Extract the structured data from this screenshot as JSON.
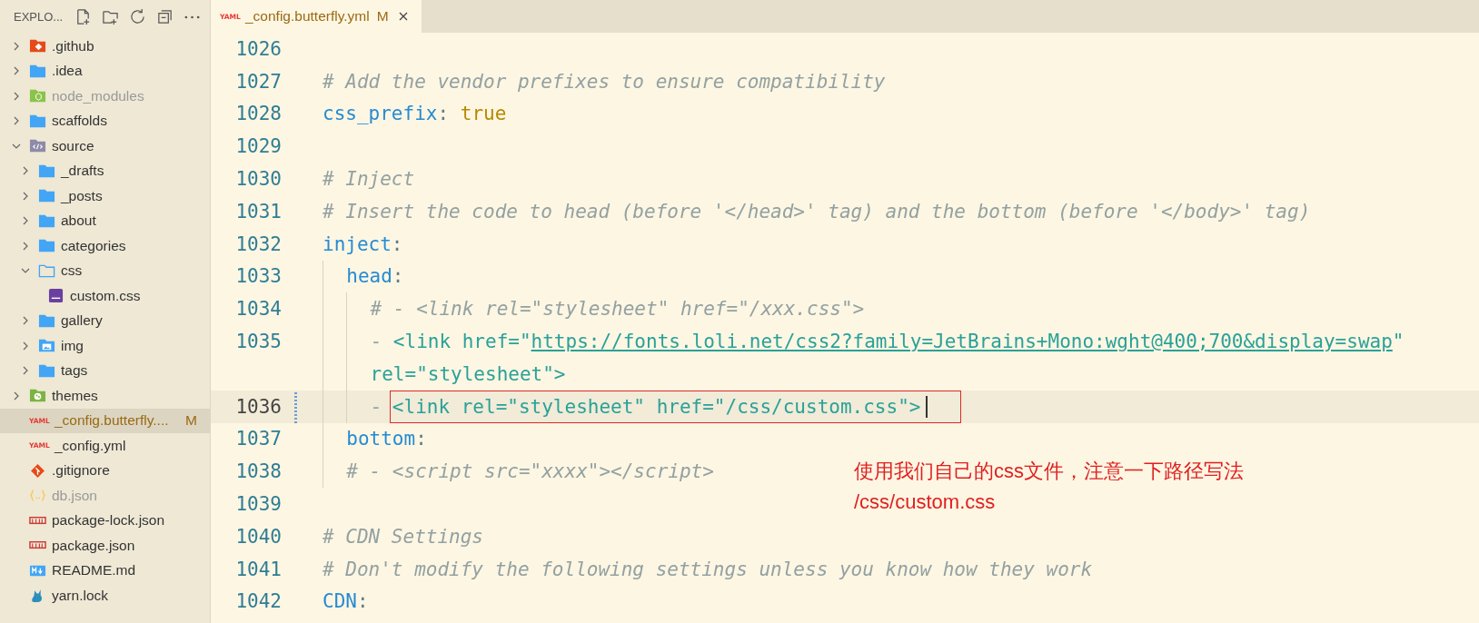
{
  "explorer": {
    "title": "EXPLO..."
  },
  "tree": [
    {
      "name": ".github",
      "kind": "git-folder",
      "expanded": false,
      "selected": false,
      "ignored": false
    },
    {
      "name": ".idea",
      "kind": "folder",
      "expanded": false,
      "selected": false,
      "ignored": false
    },
    {
      "name": "node_modules",
      "kind": "node-folder",
      "expanded": false,
      "selected": false,
      "ignored": true
    },
    {
      "name": "scaffolds",
      "kind": "folder",
      "expanded": false,
      "selected": false,
      "ignored": false
    },
    {
      "name": "source",
      "kind": "source-folder",
      "expanded": true,
      "selected": false,
      "ignored": false,
      "children": [
        {
          "name": "_drafts",
          "kind": "folder",
          "expanded": false,
          "selected": false,
          "ignored": false
        },
        {
          "name": "_posts",
          "kind": "folder",
          "expanded": false,
          "selected": false,
          "ignored": false
        },
        {
          "name": "about",
          "kind": "folder",
          "expanded": false,
          "selected": false,
          "ignored": false
        },
        {
          "name": "categories",
          "kind": "folder",
          "expanded": false,
          "selected": false,
          "ignored": false
        },
        {
          "name": "css",
          "kind": "folder",
          "expanded": true,
          "selected": false,
          "ignored": false,
          "children": [
            {
              "name": "custom.css",
              "kind": "css",
              "selected": false,
              "ignored": false
            }
          ]
        },
        {
          "name": "gallery",
          "kind": "folder",
          "expanded": false,
          "selected": false,
          "ignored": false
        },
        {
          "name": "img",
          "kind": "image-folder",
          "expanded": false,
          "selected": false,
          "ignored": false
        },
        {
          "name": "tags",
          "kind": "folder",
          "expanded": false,
          "selected": false,
          "ignored": false
        }
      ]
    },
    {
      "name": "themes",
      "kind": "theme-folder",
      "expanded": false,
      "selected": false,
      "ignored": false
    },
    {
      "name": "_config.butterfly....",
      "kind": "yaml",
      "icon_label": "YAML",
      "status": "M",
      "selected": true,
      "ignored": false
    },
    {
      "name": "_config.yml",
      "kind": "yaml",
      "icon_label": "YAML",
      "selected": false,
      "ignored": false
    },
    {
      "name": ".gitignore",
      "kind": "git",
      "selected": false,
      "ignored": false
    },
    {
      "name": "db.json",
      "kind": "json",
      "selected": false,
      "ignored": true
    },
    {
      "name": "package-lock.json",
      "kind": "npm",
      "selected": false,
      "ignored": false
    },
    {
      "name": "package.json",
      "kind": "npm",
      "selected": false,
      "ignored": false
    },
    {
      "name": "README.md",
      "kind": "markdown",
      "selected": false,
      "ignored": false
    },
    {
      "name": "yarn.lock",
      "kind": "yarn",
      "selected": false,
      "ignored": false
    }
  ],
  "tabs": [
    {
      "label": "_config.butterfly.yml",
      "icon_label": "YAML",
      "status": "M",
      "selected": true
    }
  ],
  "lines": [
    {
      "number": "1026",
      "current": false
    },
    {
      "number": "1027",
      "current": false,
      "tokens": [
        {
          "kind": "comment",
          "text": "# Add the vendor prefixes to ensure compatibility"
        }
      ]
    },
    {
      "number": "1028",
      "current": false,
      "tokens": [
        {
          "kind": "key",
          "text": "css_prefix"
        },
        {
          "kind": "punct",
          "text": ": "
        },
        {
          "kind": "bool",
          "text": "true"
        }
      ]
    },
    {
      "number": "1029",
      "current": false
    },
    {
      "number": "1030",
      "current": false,
      "tokens": [
        {
          "kind": "comment",
          "text": "# Inject"
        }
      ]
    },
    {
      "number": "1031",
      "current": false,
      "tokens": [
        {
          "kind": "comment",
          "text": "# Insert the code to head (before '</head>' tag) and the bottom (before '</body>' tag)"
        }
      ]
    },
    {
      "number": "1032",
      "current": false,
      "tokens": [
        {
          "kind": "key",
          "text": "inject"
        },
        {
          "kind": "punct",
          "text": ":"
        }
      ],
      "children": [
        {
          "number": "1033",
          "current": false,
          "tokens": [
            {
              "kind": "key",
              "text": "head"
            },
            {
              "kind": "punct",
              "text": ":"
            }
          ],
          "children": [
            {
              "number": "1034",
              "current": false,
              "tokens": [
                {
                  "kind": "comment",
                  "text": "# - <link rel=\"stylesheet\" href=\"/xxx.css\">"
                }
              ]
            },
            {
              "number": "1035",
              "current": false,
              "tokens": [
                {
                  "kind": "dash",
                  "text": "- "
                },
                {
                  "kind": "tag",
                  "text": "<link href=\""
                },
                {
                  "kind": "link",
                  "text": "https://fonts.loli.net/css2?family=JetBrains+Mono:wght@400;700&display=swap"
                },
                {
                  "kind": "tag",
                  "text": "\""
                }
              ],
              "wrap_tokens": [
                {
                  "kind": "tag",
                  "text": "rel=\"stylesheet\">"
                }
              ]
            },
            {
              "number": "1036",
              "current": true,
              "changed": true,
              "cursor": true,
              "tokens": [
                {
                  "kind": "dash",
                  "text": "- "
                },
                {
                  "kind": "tag",
                  "text": "<link rel=\"stylesheet\" href=\"/css/custom.css\">",
                  "boxed": true
                }
              ]
            }
          ]
        },
        {
          "number": "1037",
          "current": false,
          "tokens": [
            {
              "kind": "key",
              "text": "bottom"
            },
            {
              "kind": "punct",
              "text": ":"
            }
          ]
        },
        {
          "number": "1038",
          "current": false,
          "tokens": [
            {
              "kind": "comment",
              "text": "# - <script src=\"xxxx\"></script>"
            }
          ]
        }
      ]
    },
    {
      "number": "1039",
      "current": false
    },
    {
      "number": "1040",
      "current": false,
      "tokens": [
        {
          "kind": "comment",
          "text": "# CDN Settings"
        }
      ]
    },
    {
      "number": "1041",
      "current": false,
      "tokens": [
        {
          "kind": "comment",
          "text": "# Don't modify the following settings unless you know how they work"
        }
      ]
    },
    {
      "number": "1042",
      "current": false,
      "tokens": [
        {
          "kind": "key",
          "text": "CDN"
        },
        {
          "kind": "punct",
          "text": ":"
        }
      ]
    }
  ],
  "annotation": {
    "lines": [
      "使用我们自己的css文件，注意一下路径写法",
      "/css/custom.css"
    ]
  }
}
